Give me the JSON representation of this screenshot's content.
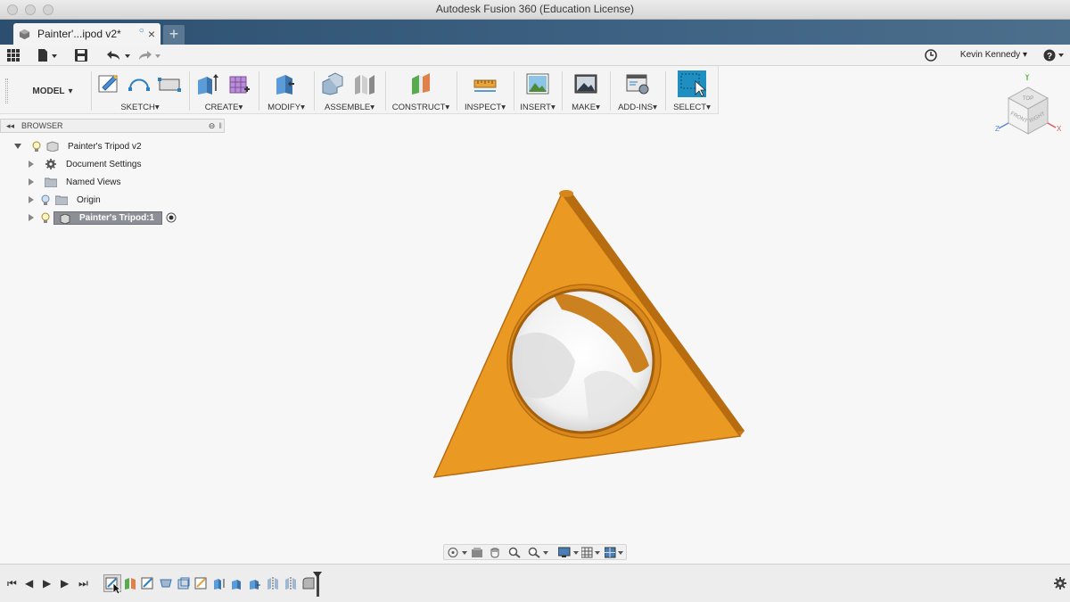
{
  "window": {
    "title": "Autodesk Fusion 360 (Education License)"
  },
  "tab": {
    "label": "Painter'...ipod v2*",
    "modified_dot": "○",
    "close": "×",
    "new_tab": "+"
  },
  "user": {
    "name": "Kevin Kennedy"
  },
  "ribbon": {
    "workspace": "MODEL",
    "groups": [
      {
        "label": "SKETCH"
      },
      {
        "label": "CREATE"
      },
      {
        "label": "MODIFY"
      },
      {
        "label": "ASSEMBLE"
      },
      {
        "label": "CONSTRUCT"
      },
      {
        "label": "INSPECT"
      },
      {
        "label": "INSERT"
      },
      {
        "label": "MAKE"
      },
      {
        "label": "ADD-INS"
      },
      {
        "label": "SELECT"
      }
    ],
    "dropdown_glyph": "▾"
  },
  "browser": {
    "title": "BROWSER",
    "items": [
      {
        "label": "Painter's Tripod v2"
      },
      {
        "label": "Document Settings"
      },
      {
        "label": "Named Views"
      },
      {
        "label": "Origin"
      },
      {
        "label": "Painter's Tripod:1"
      }
    ]
  },
  "viewcube": {
    "top": "TOP",
    "front": "FRONT",
    "right": "RIGHT",
    "axis_y": "Y",
    "axis_z": "Z",
    "axis_x": "X"
  },
  "colors": {
    "accent": "#2b7fc4",
    "model_body": "#e8981f",
    "tabbar": "#3e6283"
  },
  "icons": {
    "app_menu": "grid-icon",
    "file": "file-icon",
    "save": "save-icon",
    "undo": "undo-icon",
    "redo": "redo-icon",
    "history": "clock-icon",
    "help": "help-icon"
  },
  "timeline": {
    "controls": [
      "⏮",
      "◀",
      "▶",
      "▶",
      "⏭"
    ]
  }
}
